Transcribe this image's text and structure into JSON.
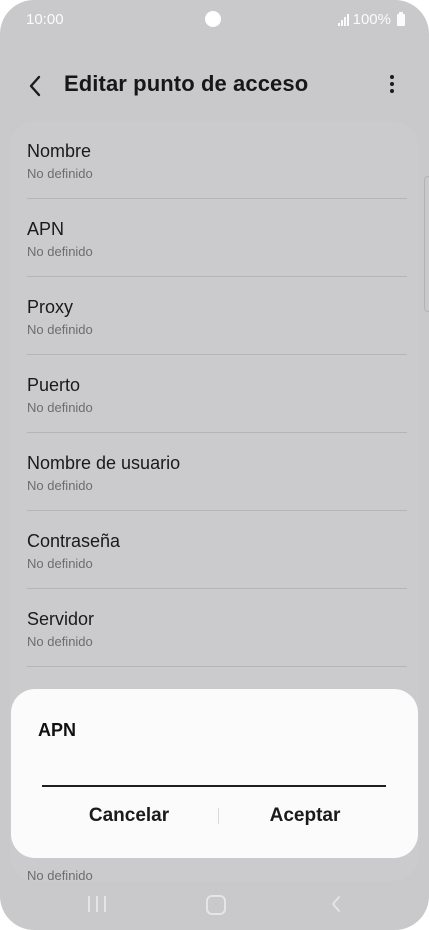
{
  "status": {
    "time": "10:00",
    "battery": "100%"
  },
  "header": {
    "title": "Editar punto de acceso"
  },
  "list": {
    "items": [
      {
        "label": "Nombre",
        "value": "No definido"
      },
      {
        "label": "APN",
        "value": "No definido"
      },
      {
        "label": "Proxy",
        "value": "No definido"
      },
      {
        "label": "Puerto",
        "value": "No definido"
      },
      {
        "label": "Nombre de usuario",
        "value": "No definido"
      },
      {
        "label": "Contraseña",
        "value": "No definido"
      },
      {
        "label": "Servidor",
        "value": "No definido"
      }
    ],
    "partial_bottom_value": "No definido"
  },
  "dialog": {
    "title": "APN",
    "input_value": "",
    "cancel_label": "Cancelar",
    "accept_label": "Aceptar"
  }
}
